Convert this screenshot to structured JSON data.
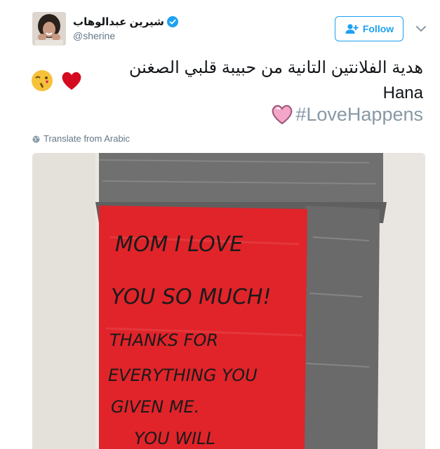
{
  "author": {
    "display_name": "شيرين عبدالوهاب",
    "handle": "@sherine",
    "verified": true
  },
  "follow_button": {
    "label": "Follow"
  },
  "tweet": {
    "text": "هدية الفلانتين التانية من حبيبة قلبي الصغنن Hana",
    "emojis_after_text": [
      "red-heart-emoji",
      "kissing-face-emoji"
    ],
    "hashtag": "#LoveHappens",
    "hashtag_emoji": "pink-heart-emoji"
  },
  "translate": {
    "label": "Translate from Arabic"
  },
  "media": {
    "handwritten_note": [
      "MOM I LOVE",
      "YOU SO MUCH!",
      "THANKS FOR",
      "EVERYTHING YOU",
      "GIVEN ME.",
      "YOU WILL"
    ]
  },
  "colors": {
    "brand_blue": "#1da1f2",
    "text": "#14171a",
    "secondary_text": "#657786",
    "hashtag": "#8899a6",
    "note_red": "#e0242a",
    "duct_tape": "#6e6e6e"
  }
}
